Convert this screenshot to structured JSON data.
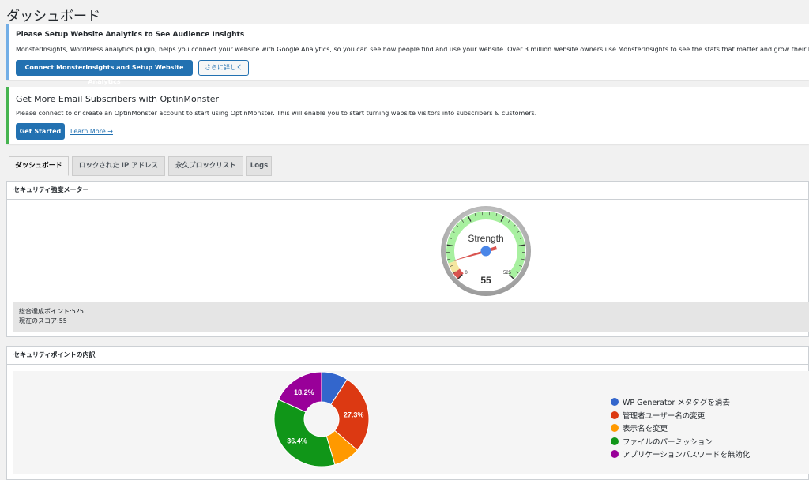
{
  "page_title": "ダッシュボード",
  "notice_analytics": {
    "title": "Please Setup Website Analytics to See Audience Insights",
    "text": "MonsterInsights, WordPress analytics plugin, helps you connect your website with Google Analytics, so you can see how people find and use your website. Over 3 million website owners use MonsterInsights to see the stats that matter and grow their business.",
    "connect_button": "Connect MonsterInsights and Setup Website Analytics",
    "more_button": "さらに詳しく"
  },
  "notice_optin": {
    "title": "Get More Email Subscribers with OptinMonster",
    "text": "Please connect to or create an OptinMonster account to start using OptinMonster. This will enable you to start turning website visitors into subscribers & customers.",
    "start_button": "Get Started",
    "learn_more": "Learn More →"
  },
  "tabs": [
    "ダッシュボード",
    "ロックされた IP アドレス",
    "永久ブロックリスト",
    "Logs"
  ],
  "strength_panel": {
    "title": "セキュリティ強度メーター",
    "gauge_label": "Strength",
    "gauge_min": "0",
    "gauge_max": "525",
    "gauge_value": "55",
    "gauge_fraction": 0.105,
    "total_points": "総合達成ポイント:525",
    "current_score": "現在のスコア:55"
  },
  "breakdown_panel": {
    "title": "セキュリティポイントの内訳"
  },
  "chart_data": {
    "type": "pie",
    "categories": [
      "WP Generator メタタグを消去",
      "管理者ユーザー名の変更",
      "表示名を変更",
      "ファイルのパーミッション",
      "アプリケーションパスワードを無効化"
    ],
    "values": [
      9.1,
      27.3,
      9.1,
      36.4,
      18.2
    ],
    "data_labels": [
      "",
      "27.3%",
      "",
      "36.4%",
      "18.2%"
    ],
    "colors": [
      "#3366cc",
      "#dc3912",
      "#ff9900",
      "#109618",
      "#990099"
    ],
    "donut": true,
    "legend_position": "right"
  }
}
